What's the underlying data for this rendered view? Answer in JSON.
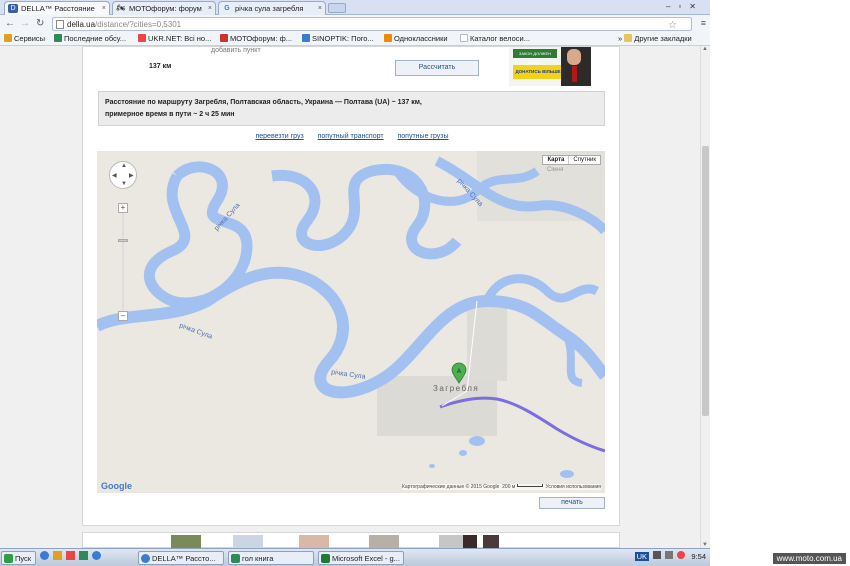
{
  "browser": {
    "tabs": [
      {
        "icon": "D",
        "label": "DELLA™ Расстояние",
        "active": true
      },
      {
        "icon": "🏍",
        "label": "МОТОфорум: форум",
        "active": false
      },
      {
        "icon": "G",
        "label": "річка сула загребля",
        "active": false
      }
    ],
    "url_host": "della.ua",
    "url_path": "/distance/?cities=0,5301",
    "bookmarks": [
      {
        "label": "Сервисы",
        "color": "#e0a020"
      },
      {
        "label": "Последние обсу...",
        "color": "#2e8b57"
      },
      {
        "label": "UKR.NET: Всі но...",
        "color": "#e44"
      },
      {
        "label": "МОТОфорум: ф...",
        "color": "#c33"
      },
      {
        "label": "SINOPTIK: Пого...",
        "color": "#3a7bd5"
      },
      {
        "label": "Одноклассники",
        "color": "#f08a00"
      },
      {
        "label": "Каталог велоси...",
        "color": "#bbb"
      }
    ],
    "other_bookmarks": "Другие закладки"
  },
  "page": {
    "add_point": "добавить пункт",
    "km": "137 км",
    "calc_button": "Рассчитать",
    "ad": {
      "top": "ЗАКОН ДОЛЖЕН ДАВАТЬ САМОПОМОЧЬ",
      "bottom": "ДОНАТИСЬ ВІЛЬШЕ"
    },
    "result_line1": "Расстояние по маршруту Загребля, Полтавская область, Украина — Полтава (UA) ~ 137 км,",
    "result_line2": "примерное время в пути ~ 2 ч 25 мин",
    "links": [
      "перевезти груз",
      "попутный транспорт",
      "попутные грузы"
    ],
    "print_button": "печать"
  },
  "map": {
    "type_map": "Карта",
    "type_sat": "Спутник",
    "river_labels": [
      "річка Сула",
      "річка Сула",
      "річка Сула",
      "річка Сула"
    ],
    "village": "Загребля",
    "marker": "A",
    "district": "Сімня",
    "google": "Google",
    "attribution": "Картографические данные © 2015 Google",
    "scale": "200 м",
    "terms": "Условия использования",
    "colors": {
      "water": "#a3c1f0",
      "land": "#ebe8e2",
      "route": "#7a6ee0",
      "marker": "#4caf50"
    }
  },
  "taskbar": {
    "start": "Пуск",
    "items": [
      {
        "label": "DELLA™ Рассто...",
        "color": "#3a7bd5"
      },
      {
        "label": "гол книга",
        "color": "#2e8b57"
      },
      {
        "label": "Microsoft Excel - g...",
        "color": "#1e7a34"
      }
    ],
    "lang": "UK",
    "time": "9:54"
  },
  "watermark": "www.moto.com.ua"
}
